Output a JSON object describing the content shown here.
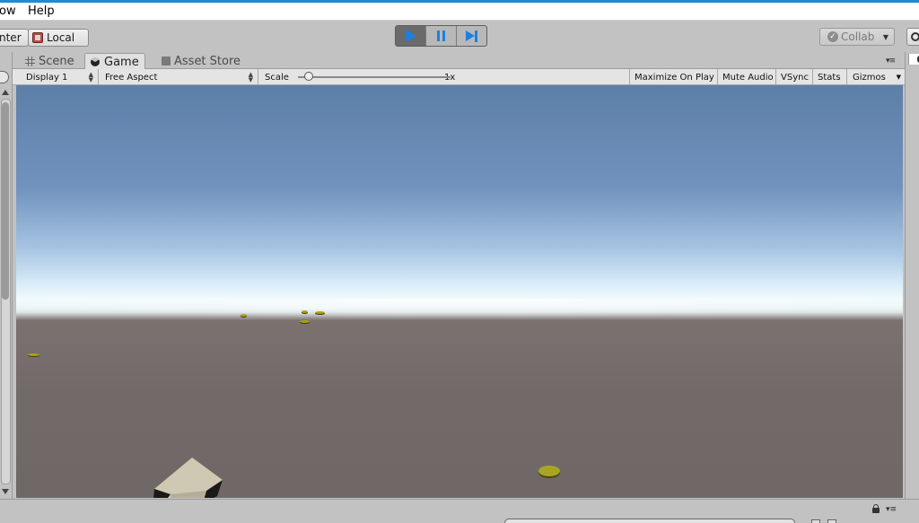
{
  "menubar": {
    "items": [
      {
        "label": "ow"
      },
      {
        "label": "Help"
      }
    ]
  },
  "toolbar": {
    "pivot_label": "nter",
    "local_label": "Local",
    "collab_label": "Collab"
  },
  "tabs": [
    {
      "label": "Scene",
      "icon": "grid-icon"
    },
    {
      "label": "Game",
      "icon": "game-controller-icon",
      "active": true
    },
    {
      "label": "Asset Store",
      "icon": "bag-icon"
    }
  ],
  "game_toolbar": {
    "display": "Display 1",
    "aspect": "Free Aspect",
    "scale_label": "Scale",
    "scale_value": "1x",
    "scale_level": 0.0,
    "maximize": "Maximize On Play",
    "mute": "Mute Audio",
    "vsync": "VSync",
    "stats": "Stats",
    "gizmos": "Gizmos"
  },
  "colors": {
    "accent_blue": "#1f7fe0",
    "window_line": "#1f8ad6",
    "sky_top": "#5c7fa8",
    "horizon": "#f2fbfd",
    "ground": "#726a68",
    "coin": "#a8a216",
    "cube": "#cfc9b4"
  }
}
